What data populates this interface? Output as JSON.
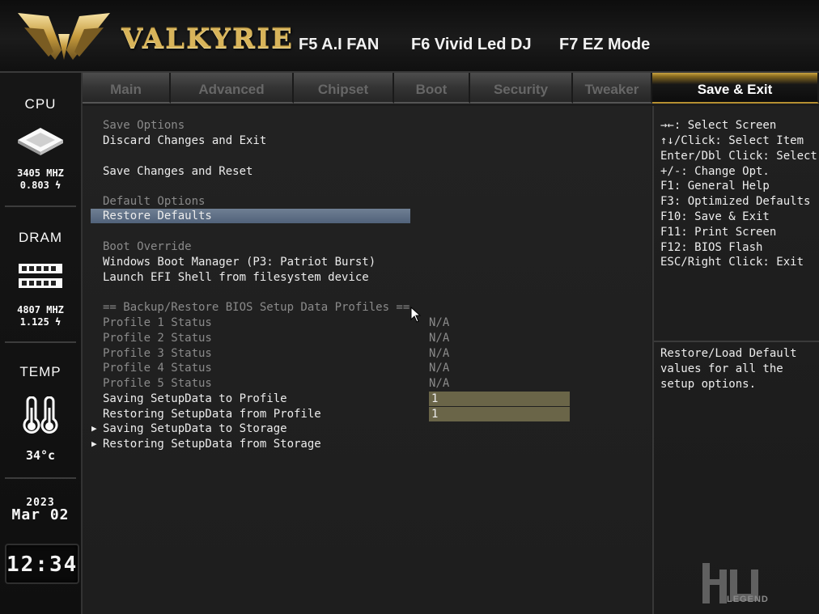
{
  "header": {
    "brand": "VALKYRIE",
    "f5_label": "F5 A.I FAN",
    "f6_label": "F6 Vivid Led DJ",
    "f7_label": "F7 EZ Mode"
  },
  "status": {
    "cpu": {
      "label": "CPU",
      "freq": "3405 MHZ",
      "volt": "0.803 ϟ"
    },
    "dram": {
      "label": "DRAM",
      "freq": "4807 MHZ",
      "volt": "1.125 ϟ"
    },
    "temp": {
      "label": "TEMP",
      "value": "34°c"
    },
    "date": {
      "year": "2023",
      "month_day": "Mar 02"
    },
    "time": "12:34"
  },
  "tabs": [
    {
      "label": "Main",
      "active": false
    },
    {
      "label": "Advanced",
      "active": false
    },
    {
      "label": "Chipset",
      "active": false
    },
    {
      "label": "Boot",
      "active": false
    },
    {
      "label": "Security",
      "active": false
    },
    {
      "label": "Tweaker",
      "active": false
    },
    {
      "label": "Save & Exit",
      "active": true
    }
  ],
  "menu": {
    "save_options_header": "Save Options",
    "discard_changes_exit": "Discard Changes and Exit",
    "save_changes_reset": "Save Changes and Reset",
    "default_options_header": "Default Options",
    "restore_defaults": "Restore Defaults",
    "boot_override_header": "Boot Override",
    "windows_boot_manager": "Windows Boot Manager (P3: Patriot Burst)",
    "launch_efi_shell": "Launch EFI Shell from filesystem device",
    "profiles_header": "== Backup/Restore BIOS Setup Data Profiles ==",
    "profiles": [
      {
        "label": "Profile 1 Status",
        "value": "N/A"
      },
      {
        "label": "Profile 2 Status",
        "value": "N/A"
      },
      {
        "label": "Profile 3 Status",
        "value": "N/A"
      },
      {
        "label": "Profile 4 Status",
        "value": "N/A"
      },
      {
        "label": "Profile 5 Status",
        "value": "N/A"
      }
    ],
    "saving_to_profile": {
      "label": "Saving SetupData to Profile",
      "value": "1"
    },
    "restoring_from_profile": {
      "label": "Restoring SetupData from Profile",
      "value": "1"
    },
    "saving_to_storage": "Saving SetupData to Storage",
    "restoring_from_storage": "Restoring SetupData from Storage",
    "submenu_arrow": "▶"
  },
  "help": {
    "lines": [
      "→←: Select Screen",
      "↑↓/Click: Select Item",
      "Enter/Dbl Click: Select",
      "+/-: Change Opt.",
      "F1: General Help",
      "F3: Optimized Defaults",
      "F10: Save & Exit",
      "F11: Print Screen",
      "F12: BIOS Flash",
      "ESC/Right Click: Exit"
    ],
    "description": "Restore/Load Default values for all the setup options."
  },
  "colors": {
    "gold_accent": "#d8b45a",
    "selection": "#5a6b82",
    "value_box": "#6a6548"
  },
  "watermark": {
    "text": "LEGEND"
  }
}
